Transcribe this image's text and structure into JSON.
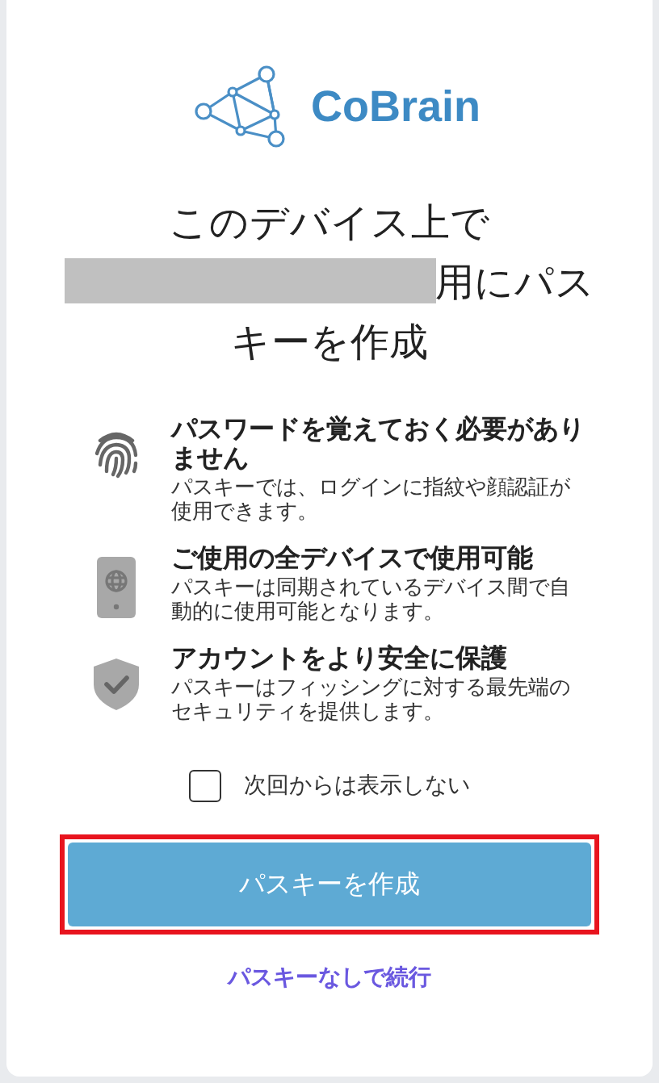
{
  "logo": {
    "text": "CoBrain"
  },
  "title": {
    "before": "このデバイス上で",
    "redacted": true,
    "after": "用にパスキーを作成"
  },
  "features": [
    {
      "kind": "fingerprint",
      "heading": "パスワードを覚えておく必要がありません",
      "text": "パスキーでは、ログインに指紋や顔認証が使用できます。"
    },
    {
      "kind": "device",
      "heading": "ご使用の全デバイスで使用可能",
      "text": "パスキーは同期されているデバイス間で自動的に使用可能となります。"
    },
    {
      "kind": "shield",
      "heading": "アカウントをより安全に保護",
      "text": "パスキーはフィッシングに対する最先端のセキュリティを提供します。"
    }
  ],
  "dont_show_again": {
    "label": "次回からは表示しない",
    "checked": false
  },
  "create_button": {
    "label": "パスキーを作成",
    "highlighted": true
  },
  "skip_link": "パスキーなしで続行"
}
